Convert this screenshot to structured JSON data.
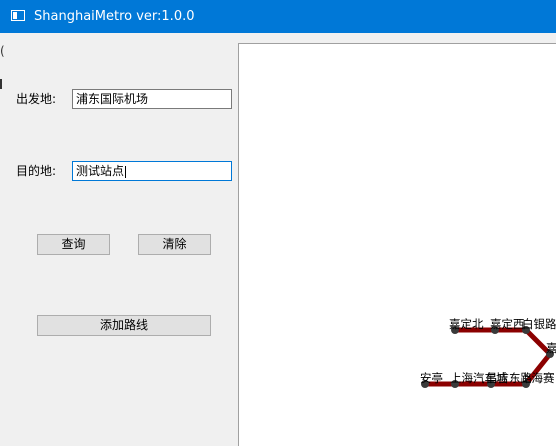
{
  "window": {
    "title": "ShanghaiMetro ver:1.0.0"
  },
  "form": {
    "origin_label": "出发地:",
    "origin_value": "浦东国际机场",
    "destination_label": "目的地:",
    "destination_value": "测试站点"
  },
  "buttons": {
    "query": "查询",
    "clear": "清除",
    "add_route": "添加路线"
  },
  "map": {
    "line_color": "#8b0000",
    "stations": [
      "嘉定北",
      "嘉定西",
      "白银路",
      "嘉",
      "安亭",
      "上海汽车城",
      "昌吉东路",
      "上海赛"
    ]
  }
}
